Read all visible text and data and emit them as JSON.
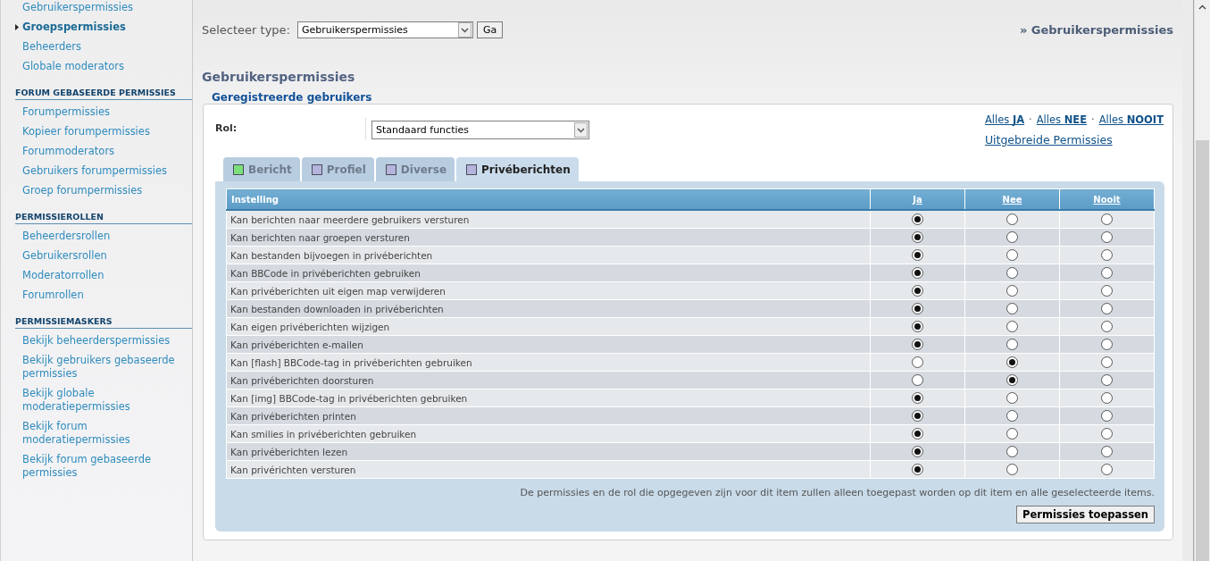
{
  "sidebar": {
    "sections": [
      {
        "items": [
          {
            "label": "Gebruikerspermissies",
            "selected": false
          },
          {
            "label": "Groepspermissies",
            "selected": true
          },
          {
            "label": "Beheerders",
            "selected": false
          },
          {
            "label": "Globale moderators",
            "selected": false
          }
        ]
      },
      {
        "heading": "FORUM GEBASEERDE PERMISSIES",
        "items": [
          {
            "label": "Forumpermissies",
            "selected": false
          },
          {
            "label": "Kopieer forumpermissies",
            "selected": false
          },
          {
            "label": "Forummoderators",
            "selected": false
          },
          {
            "label": "Gebruikers forumpermissies",
            "selected": false
          },
          {
            "label": "Groep forumpermissies",
            "selected": false
          }
        ]
      },
      {
        "heading": "PERMISSIEROLLEN",
        "items": [
          {
            "label": "Beheerdersrollen",
            "selected": false
          },
          {
            "label": "Gebruikersrollen",
            "selected": false
          },
          {
            "label": "Moderatorrollen",
            "selected": false
          },
          {
            "label": "Forumrollen",
            "selected": false
          }
        ]
      },
      {
        "heading": "PERMISSIEMASKERS",
        "items": [
          {
            "label": "Bekijk beheerderspermissies",
            "selected": false
          },
          {
            "label": "Bekijk gebruikers gebaseerde permissies",
            "selected": false
          },
          {
            "label": "Bekijk globale moderatiepermissies",
            "selected": false
          },
          {
            "label": "Bekijk forum moderatiepermissies",
            "selected": false
          },
          {
            "label": "Bekijk forum gebaseerde permissies",
            "selected": false
          }
        ]
      }
    ]
  },
  "type_select": {
    "label": "Selecteer type:",
    "value": "Gebruikerspermissies",
    "button": "Ga"
  },
  "breadcrumb": "» Gebruikerspermissies",
  "title": "Gebruikerspermissies",
  "group": {
    "legend": "Geregistreerde gebruikers",
    "role": {
      "label": "Rol:",
      "value": "Standaard functies"
    },
    "quick_links": [
      "Alles **JA**",
      "Alles **NEE**",
      "Alles **NOOIT**"
    ],
    "quick_separator": "·",
    "advanced_link": "Uitgebreide Permissies",
    "tabs": [
      {
        "label": "Bericht",
        "color": "#7be07b",
        "selected": false
      },
      {
        "label": "Profiel",
        "color": "#b4b4dc",
        "selected": false
      },
      {
        "label": "Diverse",
        "color": "#b4b4dc",
        "selected": false
      },
      {
        "label": "Privéberichten",
        "color": "#b4b4dc",
        "selected": true
      }
    ],
    "table": {
      "columns": [
        "Instelling",
        "Ja",
        "Nee",
        "Nooit"
      ],
      "rows": [
        {
          "setting": "Kan berichten naar meerdere gebruikers versturen",
          "options": [
            {
              "selected": true
            },
            {
              "selected": false
            },
            {
              "selected": false
            }
          ]
        },
        {
          "setting": "Kan berichten naar groepen versturen",
          "options": [
            {
              "selected": true
            },
            {
              "selected": false
            },
            {
              "selected": false
            }
          ]
        },
        {
          "setting": "Kan bestanden bijvoegen in privéberichten",
          "options": [
            {
              "selected": true
            },
            {
              "selected": false
            },
            {
              "selected": false
            }
          ]
        },
        {
          "setting": "Kan BBCode in privéberichten gebruiken",
          "options": [
            {
              "selected": true
            },
            {
              "selected": false
            },
            {
              "selected": false
            }
          ]
        },
        {
          "setting": "Kan privéberichten uit eigen map verwijderen",
          "options": [
            {
              "selected": true
            },
            {
              "selected": false
            },
            {
              "selected": false
            }
          ]
        },
        {
          "setting": "Kan bestanden downloaden in privéberichten",
          "options": [
            {
              "selected": true
            },
            {
              "selected": false
            },
            {
              "selected": false
            }
          ]
        },
        {
          "setting": "Kan eigen privéberichten wijzigen",
          "options": [
            {
              "selected": true
            },
            {
              "selected": false
            },
            {
              "selected": false
            }
          ]
        },
        {
          "setting": "Kan privéberichten e-mailen",
          "options": [
            {
              "selected": true
            },
            {
              "selected": false
            },
            {
              "selected": false
            }
          ]
        },
        {
          "setting": "Kan [flash] BBCode-tag in privéberichten gebruiken",
          "options": [
            {
              "selected": false
            },
            {
              "selected": true
            },
            {
              "selected": false
            }
          ]
        },
        {
          "setting": "Kan privéberichten doorsturen",
          "options": [
            {
              "selected": false
            },
            {
              "selected": true
            },
            {
              "selected": false
            }
          ]
        },
        {
          "setting": "Kan [img] BBCode-tag in privéberichten gebruiken",
          "options": [
            {
              "selected": true
            },
            {
              "selected": false
            },
            {
              "selected": false
            }
          ]
        },
        {
          "setting": "Kan privéberichten printen",
          "options": [
            {
              "selected": true
            },
            {
              "selected": false
            },
            {
              "selected": false
            }
          ]
        },
        {
          "setting": "Kan smilies in privéberichten gebruiken",
          "options": [
            {
              "selected": true
            },
            {
              "selected": false
            },
            {
              "selected": false
            }
          ]
        },
        {
          "setting": "Kan privéberichten lezen",
          "options": [
            {
              "selected": true
            },
            {
              "selected": false
            },
            {
              "selected": false
            }
          ]
        },
        {
          "setting": "Kan privérichten versturen",
          "options": [
            {
              "selected": true
            },
            {
              "selected": false
            },
            {
              "selected": false
            }
          ]
        }
      ]
    },
    "note": "De permissies en de rol die opgegeven zijn voor dit item zullen alleen toegepast worden op dit item en alle geselecteerde items.",
    "apply_button": "Permissies toepassen"
  }
}
